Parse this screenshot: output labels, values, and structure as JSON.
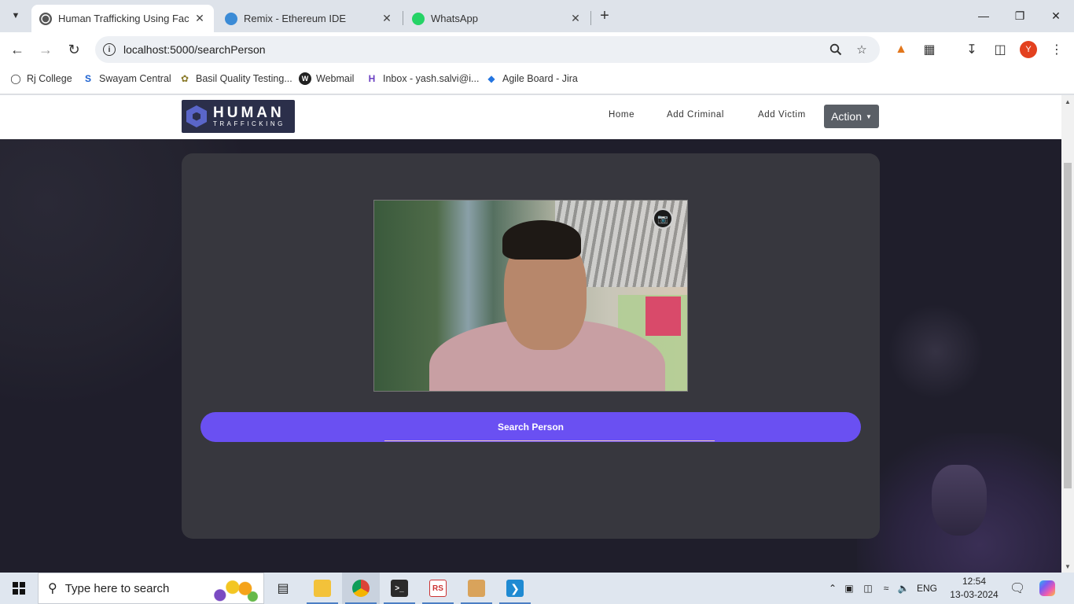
{
  "browser": {
    "tabs": [
      {
        "title": "Human Trafficking Using Face R",
        "active": true
      },
      {
        "title": "Remix - Ethereum IDE",
        "active": false
      },
      {
        "title": "WhatsApp",
        "active": false
      }
    ],
    "url": "localhost:5000/searchPerson",
    "profile_initial": "Y",
    "bookmarks": [
      {
        "label": "Rj College",
        "icon": "globe-icon"
      },
      {
        "label": "Swayam Central",
        "icon": "swayam-icon"
      },
      {
        "label": "Basil Quality Testing...",
        "icon": "basil-icon"
      },
      {
        "label": "Webmail",
        "icon": "webmail-icon"
      },
      {
        "label": "Inbox - yash.salvi@i...",
        "icon": "hcl-icon"
      },
      {
        "label": "Agile Board - Jira",
        "icon": "jira-icon"
      }
    ]
  },
  "site": {
    "logo": {
      "line1": "HUMAN",
      "line2": "TRAFFICKING"
    },
    "nav": {
      "home": "Home",
      "add_criminal": "Add Criminal",
      "add_victim": "Add Victim",
      "action": "Action"
    },
    "search_button": "Search Person"
  },
  "taskbar": {
    "search_placeholder": "Type here to search",
    "language": "ENG",
    "time": "12:54",
    "date": "13-03-2024"
  },
  "colors": {
    "accent_button": "#6a50f2",
    "card": "#37373e",
    "page_bg": "#1f1e2b"
  }
}
